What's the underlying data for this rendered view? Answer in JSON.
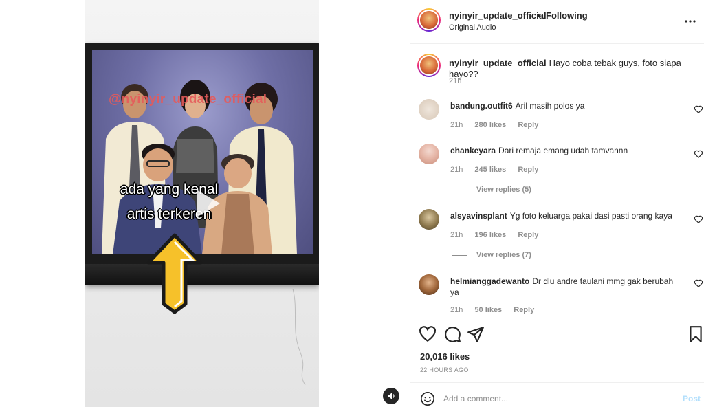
{
  "media": {
    "watermark": "@nyinyir_update_official",
    "overlay_line1": "ada yang kenal",
    "overlay_line2": "artis terkeren",
    "play_icon": "play-icon",
    "mute_icon": "speaker-icon"
  },
  "header": {
    "username": "nyinyir_update_official",
    "separator": "•",
    "follow_status": "Following",
    "audio": "Original Audio",
    "more_icon": "more-horizontal-icon"
  },
  "caption": {
    "username": "nyinyir_update_official",
    "text": "Hayo coba tebak guys, foto siapa hayo??",
    "time": "21h"
  },
  "comments": [
    {
      "username": "bandung.outfit6",
      "text": "Aril masih polos ya",
      "time": "21h",
      "likes": "280 likes",
      "reply": "Reply",
      "view_replies": ""
    },
    {
      "username": "chankeyara",
      "text": "Dari remaja emang udah tamvannn",
      "time": "21h",
      "likes": "245 likes",
      "reply": "Reply",
      "view_replies": "View replies (5)"
    },
    {
      "username": "alsyavinsplant",
      "text": "Yg foto keluarga pakai dasi pasti orang kaya",
      "time": "21h",
      "likes": "196 likes",
      "reply": "Reply",
      "view_replies": "View replies (7)"
    },
    {
      "username": "helmianggadewanto",
      "text": "Dr dlu andre taulani mmg gak berubah ya",
      "time": "21h",
      "likes": "50 likes",
      "reply": "Reply",
      "view_replies": ""
    }
  ],
  "actions": {
    "like_icon": "heart-icon",
    "comment_icon": "comment-icon",
    "share_icon": "send-icon",
    "save_icon": "bookmark-icon",
    "likes": "20,016 likes",
    "posted": "22 HOURS AGO"
  },
  "add_comment": {
    "placeholder": "Add a comment...",
    "post_label": "Post",
    "emoji_icon": "emoji-icon"
  },
  "colors": {
    "text": "#262626",
    "secondary": "#8e8e8e",
    "post_disabled": "#b2dffc",
    "divider": "#efefef"
  }
}
